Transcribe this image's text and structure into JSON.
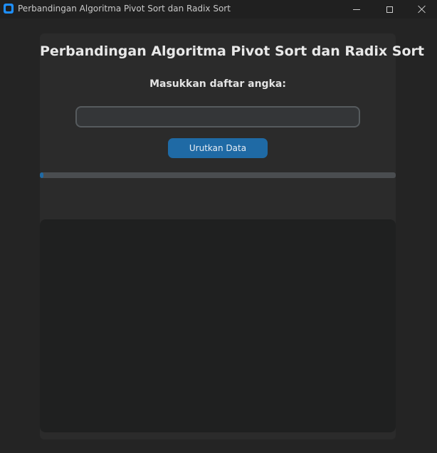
{
  "window": {
    "title": "Perbandingan Algoritma Pivot Sort dan Radix Sort",
    "icon": "app-icon",
    "controls": [
      "minimize-icon",
      "maximize-icon",
      "close-icon"
    ]
  },
  "main": {
    "heading": "Perbandingan Algoritma Pivot Sort dan Radix Sort",
    "prompt_label": "Masukkan daftar angka:",
    "input": {
      "value": "",
      "placeholder": ""
    },
    "sort_button_label": "Urutkan Data",
    "progress": 0.01,
    "output_text": ""
  },
  "colors": {
    "accent": "#1f6aa5",
    "background": "#242424",
    "frame": "#2b2b2b",
    "output_bg": "#1f2020"
  }
}
